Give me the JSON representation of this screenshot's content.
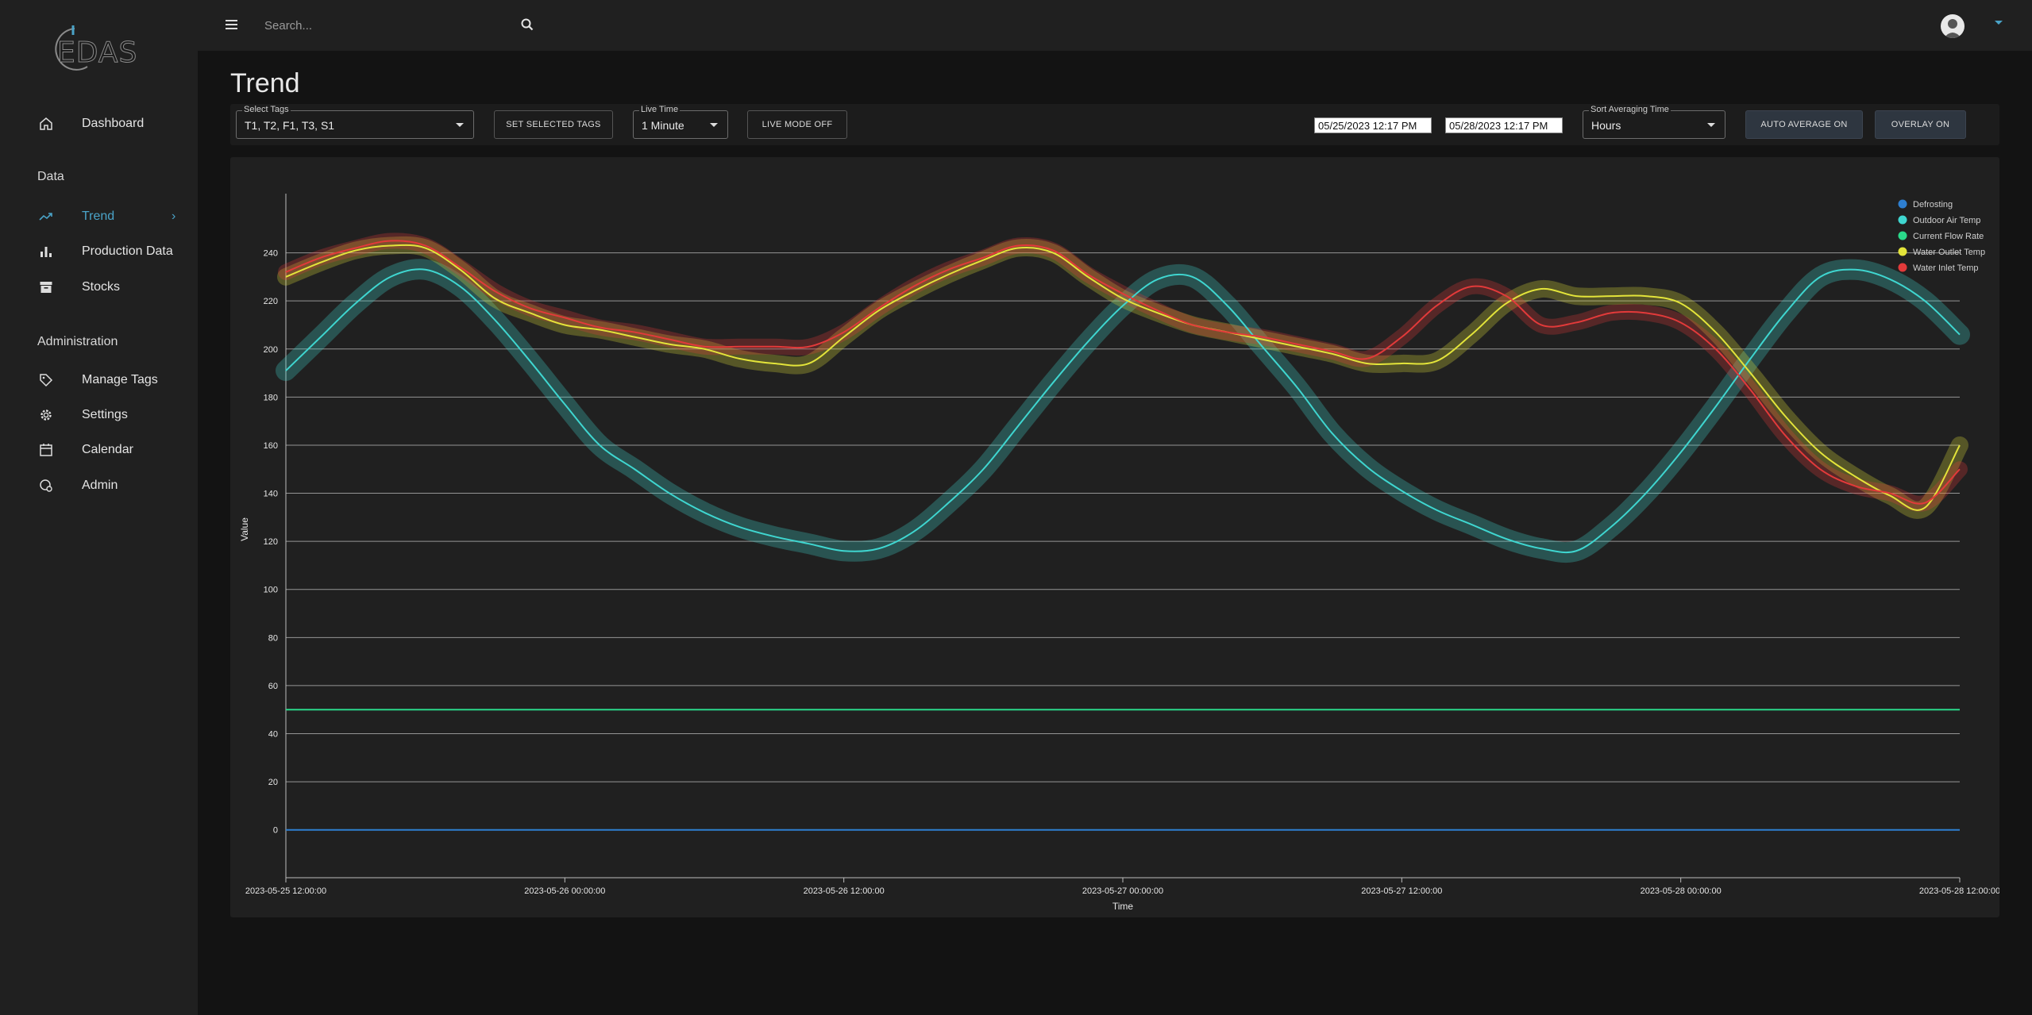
{
  "app": {
    "logo_text": "EDAS"
  },
  "sidebar": {
    "items": [
      {
        "label": "Dashboard",
        "icon": "home-icon"
      },
      {
        "label": "Trend",
        "icon": "trending-up-icon",
        "active": true
      },
      {
        "label": "Production Data",
        "icon": "bar-chart-icon"
      },
      {
        "label": "Stocks",
        "icon": "archive-icon"
      },
      {
        "label": "Manage Tags",
        "icon": "tag-icon"
      },
      {
        "label": "Settings",
        "icon": "gear-icon"
      },
      {
        "label": "Calendar",
        "icon": "calendar-icon"
      },
      {
        "label": "Admin",
        "icon": "admin-icon"
      }
    ],
    "sections": {
      "data": "Data",
      "administration": "Administration"
    }
  },
  "header": {
    "search_placeholder": "Search...",
    "icons": [
      "menu-icon",
      "search-icon",
      "moon-icon",
      "gear-icon",
      "avatar",
      "chevron-down-icon"
    ]
  },
  "page": {
    "title": "Trend"
  },
  "toolbar": {
    "select_tags_label": "Select Tags",
    "select_tags_value": "T1, T2, F1, T3, S1",
    "set_selected_tags": "SET SELECTED TAGS",
    "live_time_label": "Live Time",
    "live_time_value": "1 Minute",
    "live_mode": "LIVE MODE OFF",
    "start_date": "05/25/2023 12:17 PM",
    "end_date": "05/28/2023 12:17 PM",
    "sort_label": "Sort Averaging Time",
    "sort_value": "Hours",
    "auto_average": "AUTO AVERAGE ON",
    "overlay": "OVERLAY ON"
  },
  "colors": {
    "accent": "#4aa3c8",
    "defrosting": "#2e7fd1",
    "outdoor_air_temp": "#3fd6d0",
    "current_flow_rate": "#2ad98a",
    "water_outlet_temp": "#e3e43a",
    "water_inlet_temp": "#e23a3a"
  },
  "chart_data": {
    "type": "line",
    "xlabel": "Time",
    "ylabel": "Value",
    "ylim": [
      -10,
      260
    ],
    "yticks": [
      0,
      20,
      40,
      60,
      80,
      100,
      120,
      140,
      160,
      180,
      200,
      220,
      240
    ],
    "xticks": [
      "2023-05-25 12:00:00",
      "2023-05-26 00:00:00",
      "2023-05-26 12:00:00",
      "2023-05-27 00:00:00",
      "2023-05-27 12:00:00",
      "2023-05-28 00:00:00",
      "2023-05-28 12:00:00"
    ],
    "grid": "horizontal",
    "legend_position": "top-right",
    "x_hours": [
      0,
      1.5,
      3,
      4.5,
      6,
      7.5,
      9,
      10.5,
      12,
      13.5,
      15,
      16.5,
      18,
      19.5,
      21,
      22.5,
      24,
      25.5,
      27,
      28.5,
      30,
      31.5,
      33,
      34.5,
      36,
      37.5,
      39,
      40.5,
      42,
      43.5,
      45,
      46.5,
      48,
      49.5,
      51,
      52.5,
      54,
      55.5,
      57,
      58.5,
      60,
      61.5,
      63,
      64.5,
      66,
      67.5,
      69,
      70.5,
      72
    ],
    "series": [
      {
        "name": "Defrosting",
        "color": "#2e7fd1",
        "values": [
          0,
          0,
          0,
          0,
          0,
          0,
          0,
          0,
          0,
          0,
          0,
          0,
          0,
          0,
          0,
          0,
          0,
          0,
          0,
          0,
          0,
          0,
          0,
          0,
          0,
          0,
          0,
          0,
          0,
          0,
          0,
          0,
          0,
          0,
          0,
          0,
          0,
          0,
          0,
          0,
          0,
          0,
          0,
          0,
          0,
          0,
          0,
          0,
          0
        ]
      },
      {
        "name": "Outdoor Air Temp",
        "color": "#3fd6d0",
        "values": [
          191,
          205,
          219,
          230,
          233,
          226,
          212,
          195,
          177,
          160,
          150,
          140,
          132,
          126,
          122,
          119,
          116,
          117,
          124,
          136,
          150,
          168,
          186,
          203,
          218,
          229,
          230,
          218,
          201,
          184,
          165,
          151,
          141,
          133,
          127,
          121,
          117,
          116,
          126,
          140,
          157,
          176,
          196,
          215,
          230,
          233,
          229,
          220,
          206
        ]
      }
    ],
    "series_more": [
      {
        "name": "Current Flow Rate",
        "color": "#2ad98a",
        "values": [
          50,
          50,
          50,
          50,
          50,
          50,
          50,
          50,
          50,
          50,
          50,
          50,
          50,
          50,
          50,
          50,
          50,
          50,
          50,
          50,
          50,
          50,
          50,
          50,
          50,
          50,
          50,
          50,
          50,
          50,
          50,
          50,
          50,
          50,
          50,
          50,
          50,
          50,
          50,
          50,
          50,
          50,
          50,
          50,
          50,
          50,
          50,
          50,
          50
        ]
      },
      {
        "name": "Water Outlet Temp",
        "color": "#e3e43a",
        "values": [
          230,
          236,
          241,
          243,
          242,
          233,
          221,
          215,
          210,
          208,
          205,
          202,
          200,
          196,
          194,
          194,
          205,
          216,
          224,
          231,
          237,
          242,
          240,
          230,
          221,
          215,
          210,
          207,
          204,
          201,
          198,
          194,
          194,
          195,
          206,
          219,
          225,
          222,
          222,
          222,
          219,
          207,
          190,
          172,
          157,
          147,
          139,
          134,
          160
        ]
      },
      {
        "name": "Water Inlet Temp",
        "color": "#e23a3a",
        "values": [
          232,
          238,
          242,
          245,
          243,
          234,
          224,
          217,
          213,
          209,
          207,
          204,
          201,
          201,
          201,
          201,
          207,
          217,
          226,
          233,
          238,
          243,
          241,
          231,
          223,
          216,
          210,
          207,
          205,
          202,
          199,
          196,
          205,
          218,
          226,
          222,
          210,
          211,
          215,
          215,
          211,
          200,
          183,
          164,
          150,
          143,
          140,
          136,
          150
        ]
      }
    ]
  }
}
